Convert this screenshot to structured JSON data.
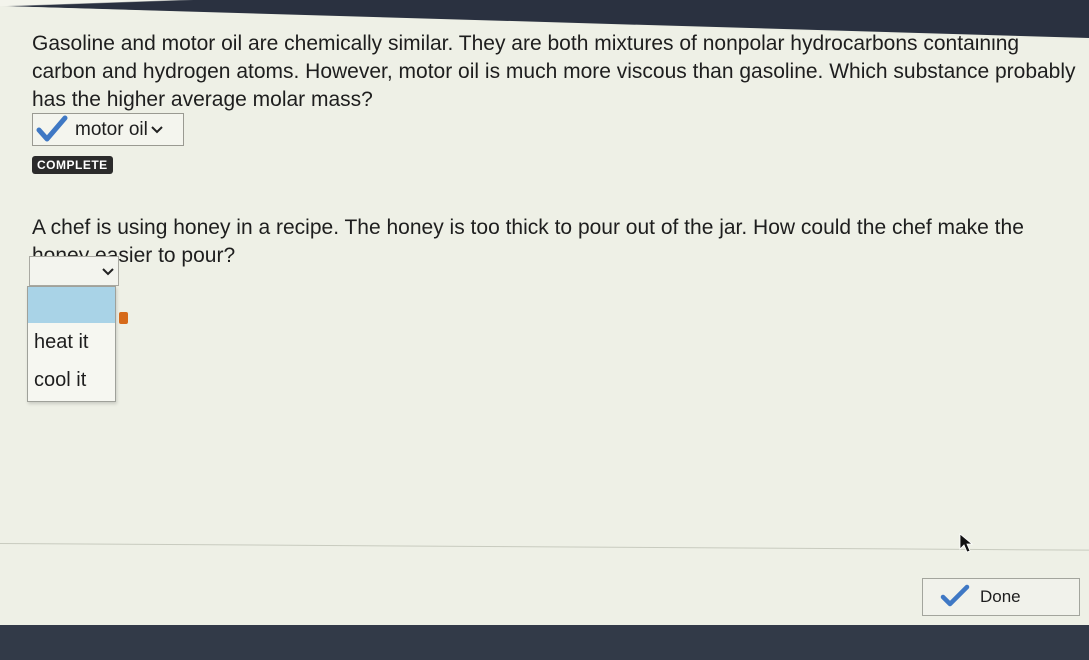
{
  "question1": {
    "text": "Gasoline and motor oil are chemically similar. They are both mixtures of nonpolar hydrocarbons containing carbon and hydrogen atoms. However, motor oil is much more viscous than gasoline. Which substance probably has the higher average molar mass?",
    "selected_answer": "motor oil",
    "status": "COMPLETE"
  },
  "question2": {
    "text": "A chef is using honey in a recipe. The honey is too thick to pour out of the jar. How could the chef make the honey easier to pour?",
    "selected_answer": "",
    "options": [
      "",
      "heat it",
      "cool it"
    ]
  },
  "footer": {
    "done_label": "Done"
  },
  "icons": {
    "check": "check-icon",
    "chevron": "chevron-down-icon",
    "pointer": "mouse-pointer-icon"
  },
  "colors": {
    "check": "#3f78c4",
    "highlight": "#a9d3e7",
    "badge": "#2b2b2b"
  }
}
